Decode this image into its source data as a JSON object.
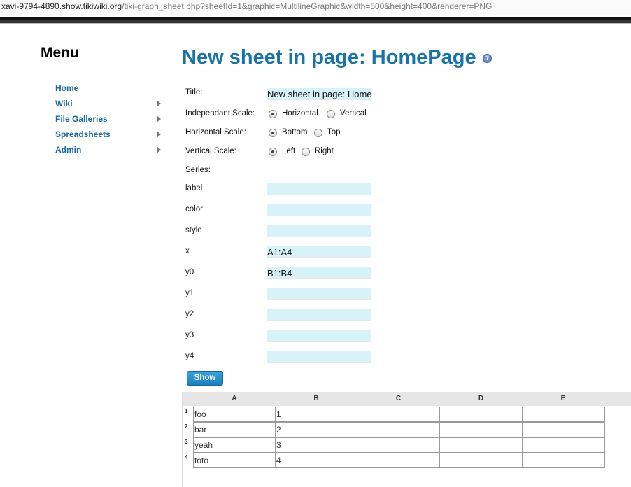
{
  "browser": {
    "url_host": "xavi-9794-4890.show.tikiwiki.org",
    "url_path": "/tiki-graph_sheet.php?sheetId=1&graphic=MultilineGraphic&width=500&height=400&renderer=PNG"
  },
  "menu": {
    "title": "Menu",
    "items": [
      {
        "label": "Home",
        "has_submenu": false
      },
      {
        "label": "Wiki",
        "has_submenu": true
      },
      {
        "label": "File Galleries",
        "has_submenu": true
      },
      {
        "label": "Spreadsheets",
        "has_submenu": true
      },
      {
        "label": "Admin",
        "has_submenu": true
      }
    ]
  },
  "page": {
    "title": "New sheet in page: HomePage",
    "help_icon": "help-icon"
  },
  "form": {
    "title_label": "Title:",
    "title_value": "New sheet in page: HomePage",
    "independent_scale": {
      "label": "Independant Scale:",
      "options": [
        "Horizontal",
        "Vertical"
      ],
      "selected": "Horizontal"
    },
    "horizontal_scale": {
      "label": "Horizontal Scale:",
      "options": [
        "Bottom",
        "Top"
      ],
      "selected": "Bottom"
    },
    "vertical_scale": {
      "label": "Vertical Scale:",
      "options": [
        "Left",
        "Right"
      ],
      "selected": "Left"
    },
    "series_label": "Series:",
    "series_fields": [
      {
        "label": "label",
        "value": ""
      },
      {
        "label": "color",
        "value": ""
      },
      {
        "label": "style",
        "value": ""
      },
      {
        "label": "x",
        "value": "A1:A4"
      },
      {
        "label": "y0",
        "value": "B1:B4"
      },
      {
        "label": "y1",
        "value": ""
      },
      {
        "label": "y2",
        "value": ""
      },
      {
        "label": "y3",
        "value": ""
      },
      {
        "label": "y4",
        "value": ""
      }
    ],
    "show_button": "Show"
  },
  "sheet": {
    "columns": [
      "A",
      "B",
      "C",
      "D",
      "E"
    ],
    "rows": [
      {
        "num": "1",
        "cells": [
          "foo",
          "1",
          "",
          "",
          ""
        ]
      },
      {
        "num": "2",
        "cells": [
          "bar",
          "2",
          "",
          "",
          ""
        ]
      },
      {
        "num": "3",
        "cells": [
          "yeah",
          "3",
          "",
          "",
          ""
        ]
      },
      {
        "num": "4",
        "cells": [
          "toto",
          "4",
          "",
          "",
          ""
        ]
      }
    ]
  },
  "colors": {
    "accent": "#1a73a8",
    "link": "#1b6aa0",
    "input_bg": "#d8f2f9",
    "button": "#1c7fbf"
  }
}
